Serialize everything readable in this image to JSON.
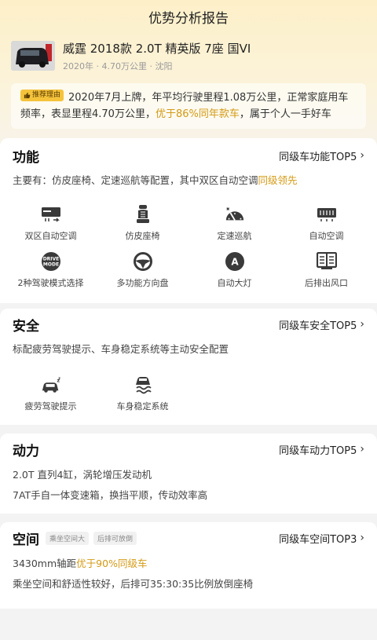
{
  "header": {
    "title": "优势分析报告"
  },
  "car": {
    "title": "威霆 2018款 2.0T 精英版 7座 国VI",
    "meta": "2020年 · 4.70万公里 · 沈阳"
  },
  "reason": {
    "tag": "推荐理由",
    "text_a": "2020年7月上牌，年平均行驶里程1.08万公里，正常家庭用车频率，表显里程4.70万公里，",
    "text_highlight": "优于86%同年款车",
    "text_b": "，属于个人一手好车"
  },
  "sections": {
    "function": {
      "title": "功能",
      "link": "同级车功能TOP5",
      "desc_a": "主要有：仿皮座椅、定速巡航等配置，其中双区自动空调",
      "desc_hl": "同级领先",
      "features": [
        {
          "label": "双区自动空调",
          "icon": "ac-panel-icon"
        },
        {
          "label": "仿皮座椅",
          "icon": "seat-icon"
        },
        {
          "label": "定速巡航",
          "icon": "speedometer-icon"
        },
        {
          "label": "自动空调",
          "icon": "ac-vent-icon"
        },
        {
          "label": "2种驾驶模式选择",
          "icon": "drive-mode-icon"
        },
        {
          "label": "多功能方向盘",
          "icon": "steering-wheel-icon"
        },
        {
          "label": "自动大灯",
          "icon": "headlight-icon"
        },
        {
          "label": "后排出风口",
          "icon": "rear-vent-icon"
        }
      ]
    },
    "safety": {
      "title": "安全",
      "link": "同级车安全TOP5",
      "desc": "标配疲劳驾驶提示、车身稳定系统等主动安全配置",
      "features": [
        {
          "label": "疲劳驾驶提示",
          "icon": "fatigue-alert-icon"
        },
        {
          "label": "车身稳定系统",
          "icon": "stability-control-icon"
        }
      ]
    },
    "power": {
      "title": "动力",
      "link": "同级车动力TOP5",
      "line1": "2.0T 直列4缸，涡轮增压发动机",
      "line2": "7AT手自一体变速箱，换挡平顺，传动效率高"
    },
    "space": {
      "title": "空间",
      "chips": [
        "乘坐空间大",
        "后排可放倒"
      ],
      "link": "同级车空间TOP3",
      "line1_a": "3430mm轴距",
      "line1_hl": "优于90%同级车",
      "line2": "乘坐空间和舒适性较好，后排可35:30:35比例放倒座椅"
    }
  },
  "colors": {
    "accent": "#d49a14",
    "tag_bg": "#f5c33b"
  }
}
